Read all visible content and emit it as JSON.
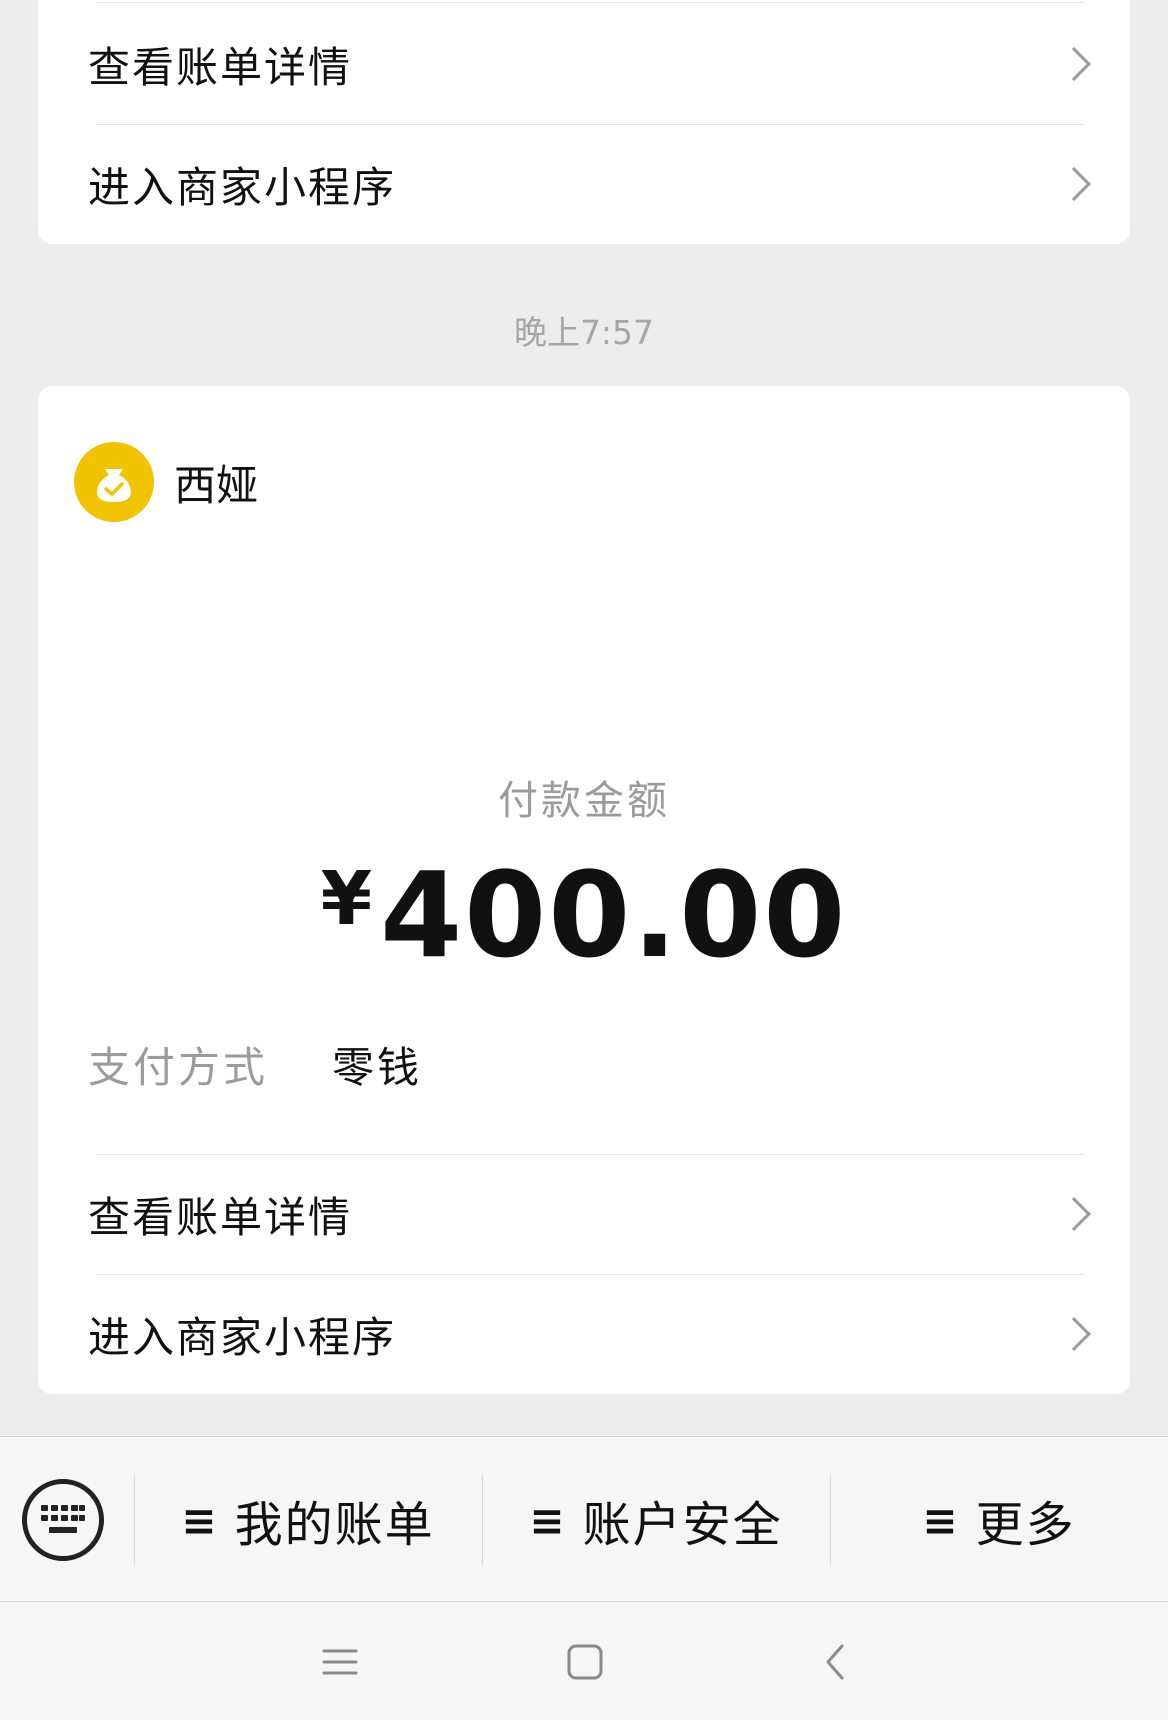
{
  "card_top": {
    "rows": [
      {
        "label": "查看账单详情"
      },
      {
        "label": "进入商家小程序"
      }
    ]
  },
  "timestamp": "晚上7:57",
  "payment": {
    "merchant": {
      "name": "西娅",
      "logo_icon": "money-bag-icon",
      "logo_color": "#f0c400"
    },
    "amount_label": "付款金额",
    "currency": "¥",
    "amount": "400.00",
    "method_label": "支付方式",
    "method_value": "零钱",
    "rows": [
      {
        "label": "查看账单详情"
      },
      {
        "label": "进入商家小程序"
      }
    ]
  },
  "bottom_menu": {
    "keyboard_icon": "keyboard-icon",
    "menu_glyph": "≡",
    "items": [
      {
        "label": "我的账单"
      },
      {
        "label": "账户安全"
      },
      {
        "label": "更多"
      }
    ]
  },
  "nav_bar": {
    "icons": [
      "menu-icon",
      "home-icon",
      "back-icon"
    ]
  }
}
